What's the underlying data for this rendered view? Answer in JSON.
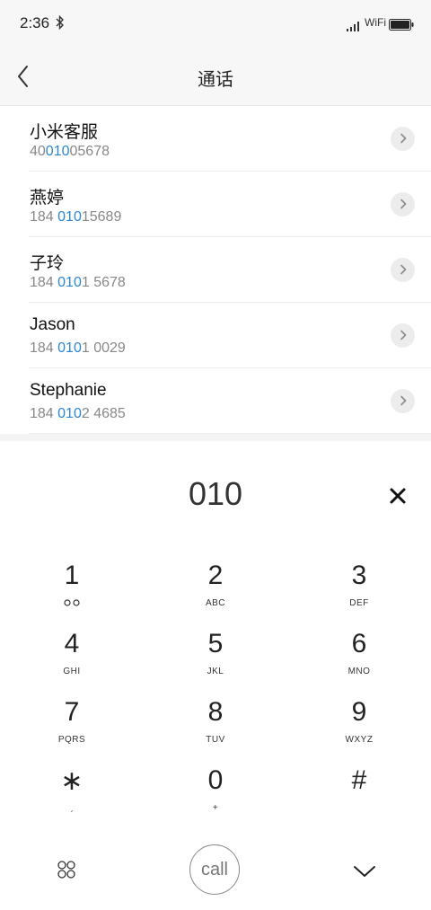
{
  "status_bar": {
    "time": "2:36",
    "bluetooth_icon": "bluetooth-icon",
    "signal_icon": "signal-bars-icon",
    "network": "WiFi",
    "battery_icon": "battery-icon"
  },
  "header": {
    "title": "通话",
    "back_icon": "chevron-left-icon"
  },
  "contacts": [
    {
      "name": "小米客服",
      "number_pre": "40",
      "number_match": "010",
      "number_post": "05678"
    },
    {
      "name": "燕婷",
      "number_pre": "184 ",
      "number_match": "010",
      "number_post": "15689"
    },
    {
      "name": "子玲",
      "number_pre": "184 ",
      "number_match": "010",
      "number_post": "1 5678"
    },
    {
      "name": "Jason",
      "number_pre": "184 ",
      "number_match": "010",
      "number_post": "1 0029"
    },
    {
      "name": "Stephanie",
      "number_pre": "184 ",
      "number_match": "010",
      "number_post": "2 4685"
    }
  ],
  "dialer": {
    "input": "010",
    "clear_icon": "close-icon",
    "keys": [
      {
        "digit": "1",
        "sub": "ᴏᴏ"
      },
      {
        "digit": "2",
        "sub": "ABC"
      },
      {
        "digit": "3",
        "sub": "DEF"
      },
      {
        "digit": "4",
        "sub": "GHI"
      },
      {
        "digit": "5",
        "sub": "JKL"
      },
      {
        "digit": "6",
        "sub": "MNO"
      },
      {
        "digit": "7",
        "sub": "PQRS"
      },
      {
        "digit": "8",
        "sub": "TUV"
      },
      {
        "digit": "9",
        "sub": "WXYZ"
      },
      {
        "digit": "∗",
        "sub": "ˏ"
      },
      {
        "digit": "0",
        "sub": "+"
      },
      {
        "digit": "#",
        "sub": ""
      }
    ],
    "call_label": "call",
    "menu_icon": "four-circles-icon",
    "collapse_icon": "chevron-down-icon"
  },
  "colors": {
    "match_highlight": "#2a86d8",
    "number_gray": "#888888",
    "bar_background": "#f7f7f7"
  }
}
